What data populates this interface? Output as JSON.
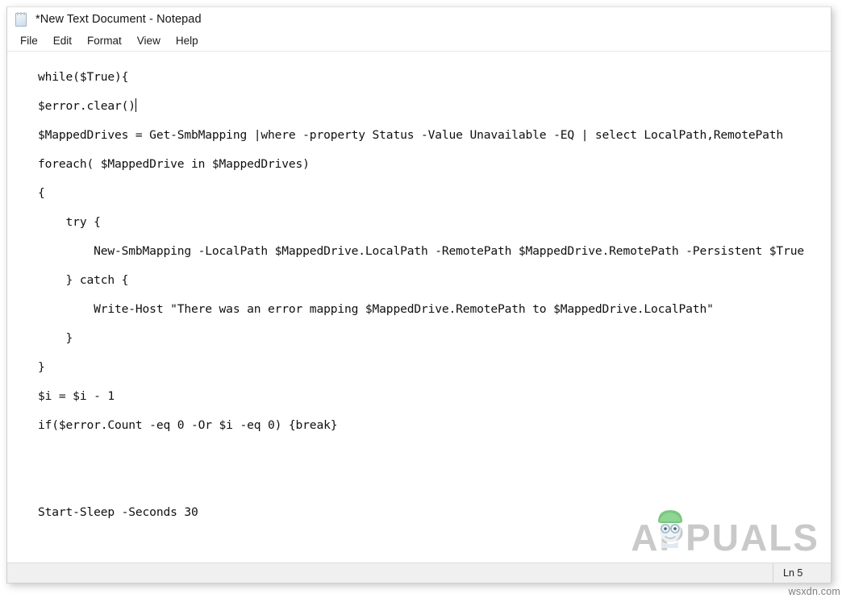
{
  "window": {
    "title": "*New Text Document - Notepad",
    "icon": "notepad-icon"
  },
  "menubar": {
    "items": [
      {
        "label": "File"
      },
      {
        "label": "Edit"
      },
      {
        "label": "Format"
      },
      {
        "label": "View"
      },
      {
        "label": "Help"
      }
    ]
  },
  "editor": {
    "lines": [
      "while($True){",
      "$error.clear()",
      "$MappedDrives = Get-SmbMapping |where -property Status -Value Unavailable -EQ | select LocalPath,RemotePath",
      "foreach( $MappedDrive in $MappedDrives)",
      "{",
      "    try {",
      "        New-SmbMapping -LocalPath $MappedDrive.LocalPath -RemotePath $MappedDrive.RemotePath -Persistent $True",
      "    } catch {",
      "        Write-Host \"There was an error mapping $MappedDrive.RemotePath to $MappedDrive.LocalPath\"",
      "    }",
      "}",
      "$i = $i - 1",
      "if($error.Count -eq 0 -Or $i -eq 0) {break}",
      "",
      "",
      "Start-Sleep -Seconds 30",
      "",
      ""
    ],
    "caret_line_index": 1,
    "tail_line": "}"
  },
  "statusbar": {
    "position_label": "Ln 5"
  },
  "watermark": {
    "brand": "APPUALS",
    "mascot": "appuals-mascot-icon",
    "site": "wsxdn.com",
    "color": "#c9c9c9"
  }
}
